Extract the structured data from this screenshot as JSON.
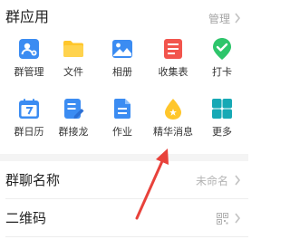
{
  "section": {
    "title": "群应用",
    "manage_label": "管理"
  },
  "apps": [
    {
      "label": "群管理",
      "icon": "group-manage-icon"
    },
    {
      "label": "文件",
      "icon": "folder-icon"
    },
    {
      "label": "相册",
      "icon": "photo-album-icon"
    },
    {
      "label": "收集表",
      "icon": "form-icon"
    },
    {
      "label": "打卡",
      "icon": "check-in-icon"
    },
    {
      "label": "群日历",
      "icon": "calendar-icon"
    },
    {
      "label": "群接龙",
      "icon": "relay-icon"
    },
    {
      "label": "作业",
      "icon": "homework-icon"
    },
    {
      "label": "精华消息",
      "icon": "featured-message-icon"
    },
    {
      "label": "更多",
      "icon": "more-apps-icon"
    }
  ],
  "settings": {
    "group_name": {
      "label": "群聊名称",
      "value": "未命名"
    },
    "qr_code": {
      "label": "二维码"
    }
  },
  "colors": {
    "blue": "#3b8cf2",
    "yellow": "#ffc62b",
    "red": "#f2554d",
    "green": "#2ec56b",
    "teal": "#17a9b5",
    "annotation_arrow": "#e8423b"
  }
}
